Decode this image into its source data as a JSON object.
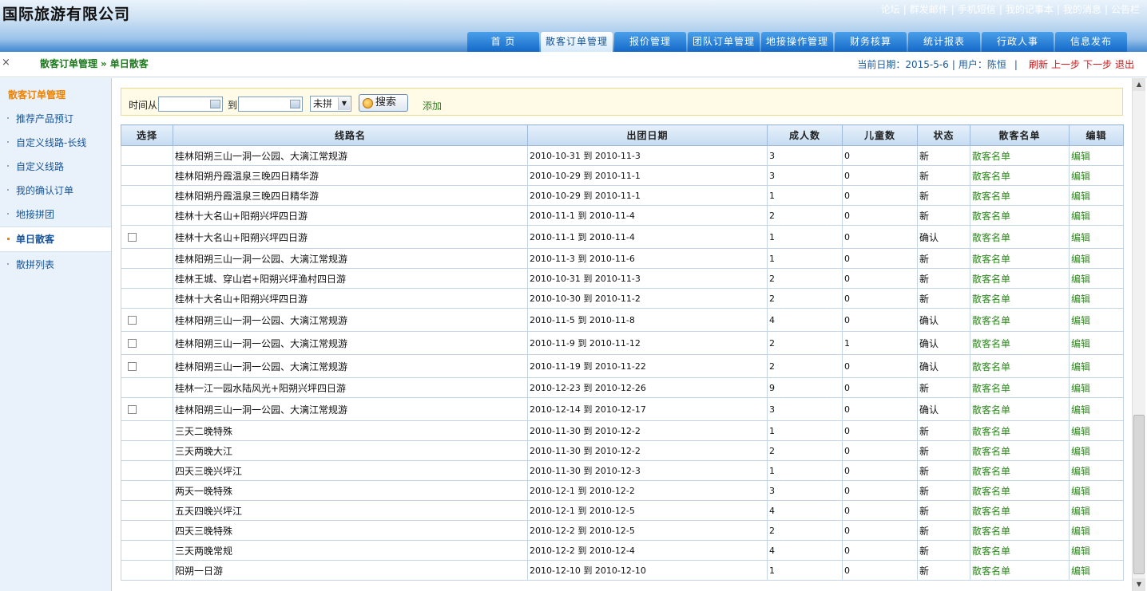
{
  "header": {
    "logo": "国际旅游有限公司",
    "top_links": [
      "论坛",
      "群发邮件",
      "手机短信",
      "我的记事本",
      "我的消息",
      "公告栏"
    ],
    "nav": [
      "首 页",
      "散客订单管理",
      "报价管理",
      "团队订单管理",
      "地接操作管理",
      "财务核算",
      "统计报表",
      "行政人事",
      "信息发布"
    ],
    "nav_active_index": 1
  },
  "subbar": {
    "close": "×",
    "breadcrumb": [
      "散客订单管理",
      "单日散客"
    ],
    "breadcrumb_sep": "»",
    "date_label": "当前日期：2015-5-6",
    "user_label": "用户：陈恒",
    "actions": [
      "刷新",
      "上一步",
      "下一步",
      "退出"
    ]
  },
  "sidebar": {
    "title": "散客订单管理",
    "items": [
      "推荐产品预订",
      "自定义线路-长线",
      "自定义线路",
      "我的确认订单",
      "地接拼团",
      "单日散客",
      "散拼列表"
    ],
    "active_index": 5
  },
  "search": {
    "from_label": "时间从",
    "to_label": "到",
    "from_value": "",
    "to_value": "",
    "status_value": "未拼",
    "search_button": "搜索",
    "add_link": "添加"
  },
  "table": {
    "headers": [
      "选择",
      "线路名",
      "出团日期",
      "成人数",
      "儿童数",
      "状态",
      "散客名单",
      "编辑"
    ],
    "rows": [
      {
        "check": false,
        "name": "桂林阳朔三山一洞一公园、大漓江常规游",
        "date": "2010-10-31 到 2010-11-3",
        "adults": "3",
        "children": "0",
        "status": "新",
        "list": "散客名单",
        "edit": "编辑"
      },
      {
        "check": false,
        "name": "桂林阳朔丹霞温泉三晚四日精华游",
        "date": "2010-10-29 到 2010-11-1",
        "adults": "3",
        "children": "0",
        "status": "新",
        "list": "散客名单",
        "edit": "编辑"
      },
      {
        "check": false,
        "name": "桂林阳朔丹霞温泉三晚四日精华游",
        "date": "2010-10-29 到 2010-11-1",
        "adults": "1",
        "children": "0",
        "status": "新",
        "list": "散客名单",
        "edit": "编辑"
      },
      {
        "check": false,
        "name": "桂林十大名山+阳朔兴坪四日游",
        "date": "2010-11-1 到 2010-11-4",
        "adults": "2",
        "children": "0",
        "status": "新",
        "list": "散客名单",
        "edit": "编辑"
      },
      {
        "check": true,
        "name": "桂林十大名山+阳朔兴坪四日游",
        "date": "2010-11-1 到 2010-11-4",
        "adults": "1",
        "children": "0",
        "status": "确认",
        "list": "散客名单",
        "edit": "编辑"
      },
      {
        "check": false,
        "name": "桂林阳朔三山一洞一公园、大漓江常规游",
        "date": "2010-11-3 到 2010-11-6",
        "adults": "1",
        "children": "0",
        "status": "新",
        "list": "散客名单",
        "edit": "编辑"
      },
      {
        "check": false,
        "name": "桂林王城、穿山岩+阳朔兴坪渔村四日游",
        "date": "2010-10-31 到 2010-11-3",
        "adults": "2",
        "children": "0",
        "status": "新",
        "list": "散客名单",
        "edit": "编辑"
      },
      {
        "check": false,
        "name": "桂林十大名山+阳朔兴坪四日游",
        "date": "2010-10-30 到 2010-11-2",
        "adults": "2",
        "children": "0",
        "status": "新",
        "list": "散客名单",
        "edit": "编辑"
      },
      {
        "check": true,
        "name": "桂林阳朔三山一洞一公园、大漓江常规游",
        "date": "2010-11-5 到 2010-11-8",
        "adults": "4",
        "children": "0",
        "status": "确认",
        "list": "散客名单",
        "edit": "编辑"
      },
      {
        "check": true,
        "name": "桂林阳朔三山一洞一公园、大漓江常规游",
        "date": "2010-11-9 到 2010-11-12",
        "adults": "2",
        "children": "1",
        "status": "确认",
        "list": "散客名单",
        "edit": "编辑"
      },
      {
        "check": true,
        "name": "桂林阳朔三山一洞一公园、大漓江常规游",
        "date": "2010-11-19 到 2010-11-22",
        "adults": "2",
        "children": "0",
        "status": "确认",
        "list": "散客名单",
        "edit": "编辑"
      },
      {
        "check": false,
        "name": "桂林一江一园水陆风光+阳朔兴坪四日游",
        "date": "2010-12-23 到 2010-12-26",
        "adults": "9",
        "children": "0",
        "status": "新",
        "list": "散客名单",
        "edit": "编辑"
      },
      {
        "check": true,
        "name": "桂林阳朔三山一洞一公园、大漓江常规游",
        "date": "2010-12-14 到 2010-12-17",
        "adults": "3",
        "children": "0",
        "status": "确认",
        "list": "散客名单",
        "edit": "编辑"
      },
      {
        "check": false,
        "name": "三天二晚特殊",
        "date": "2010-11-30 到 2010-12-2",
        "adults": "1",
        "children": "0",
        "status": "新",
        "list": "散客名单",
        "edit": "编辑"
      },
      {
        "check": false,
        "name": "三天两晚大江",
        "date": "2010-11-30 到 2010-12-2",
        "adults": "2",
        "children": "0",
        "status": "新",
        "list": "散客名单",
        "edit": "编辑"
      },
      {
        "check": false,
        "name": "四天三晚兴坪江",
        "date": "2010-11-30 到 2010-12-3",
        "adults": "1",
        "children": "0",
        "status": "新",
        "list": "散客名单",
        "edit": "编辑"
      },
      {
        "check": false,
        "name": "两天一晚特殊",
        "date": "2010-12-1 到 2010-12-2",
        "adults": "3",
        "children": "0",
        "status": "新",
        "list": "散客名单",
        "edit": "编辑"
      },
      {
        "check": false,
        "name": "五天四晚兴坪江",
        "date": "2010-12-1 到 2010-12-5",
        "adults": "4",
        "children": "0",
        "status": "新",
        "list": "散客名单",
        "edit": "编辑"
      },
      {
        "check": false,
        "name": "四天三晚特殊",
        "date": "2010-12-2 到 2010-12-5",
        "adults": "2",
        "children": "0",
        "status": "新",
        "list": "散客名单",
        "edit": "编辑"
      },
      {
        "check": false,
        "name": "三天两晚常规",
        "date": "2010-12-2 到 2010-12-4",
        "adults": "4",
        "children": "0",
        "status": "新",
        "list": "散客名单",
        "edit": "编辑"
      },
      {
        "check": false,
        "name": "阳朔一日游",
        "date": "2010-12-10 到 2010-12-10",
        "adults": "1",
        "children": "0",
        "status": "新",
        "list": "散客名单",
        "edit": "编辑"
      }
    ]
  }
}
